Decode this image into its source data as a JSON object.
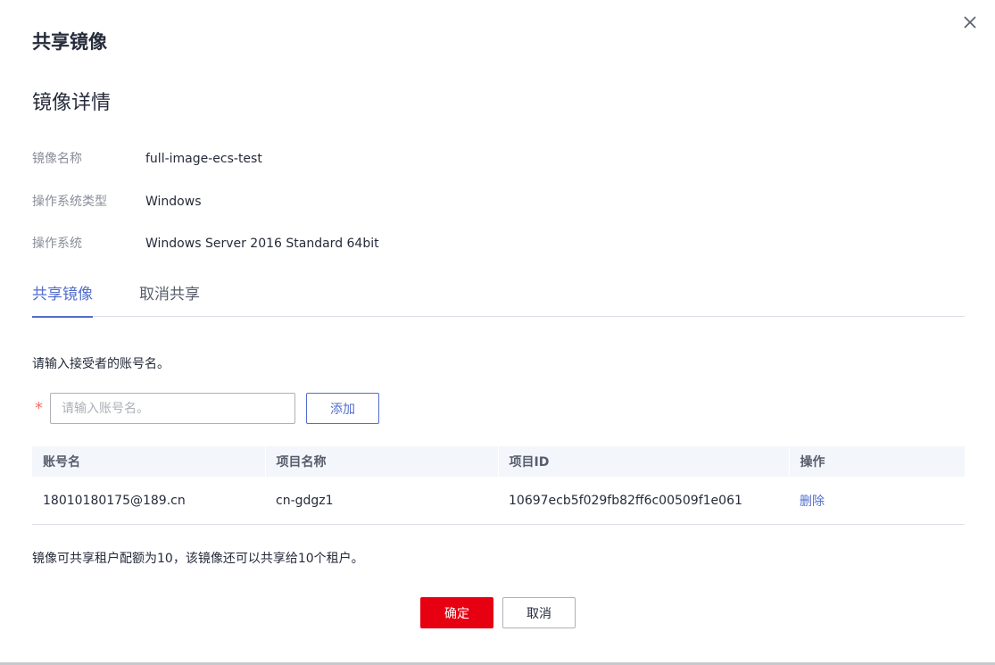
{
  "dialog": {
    "title": "共享镜像",
    "close_icon": "close-icon"
  },
  "details": {
    "section_title": "镜像详情",
    "rows": [
      {
        "label": "镜像名称",
        "value": "full-image-ecs-test"
      },
      {
        "label": "操作系统类型",
        "value": "Windows"
      },
      {
        "label": "操作系统",
        "value": "Windows Server 2016 Standard 64bit"
      }
    ]
  },
  "tabs": [
    {
      "label": "共享镜像",
      "active": true
    },
    {
      "label": "取消共享",
      "active": false
    }
  ],
  "form": {
    "hint": "请输入接受者的账号名。",
    "required_mark": "*",
    "input_value": "",
    "input_placeholder": "请输入账号名。",
    "add_label": "添加"
  },
  "table": {
    "headers": [
      "账号名",
      "项目名称",
      "项目ID",
      "操作"
    ],
    "rows": [
      {
        "account": "18010180175@189.cn",
        "project_name": "cn-gdgz1",
        "project_id": "10697ecb5f029fb82ff6c00509f1e061",
        "action": "删除"
      }
    ]
  },
  "quota_note": "镜像可共享租户配额为10，该镜像还可以共享给10个租户。",
  "footer": {
    "confirm_label": "确定",
    "cancel_label": "取消"
  },
  "colors": {
    "accent": "#526ecc",
    "confirm": "#e60012",
    "required": "#f66f6a"
  }
}
